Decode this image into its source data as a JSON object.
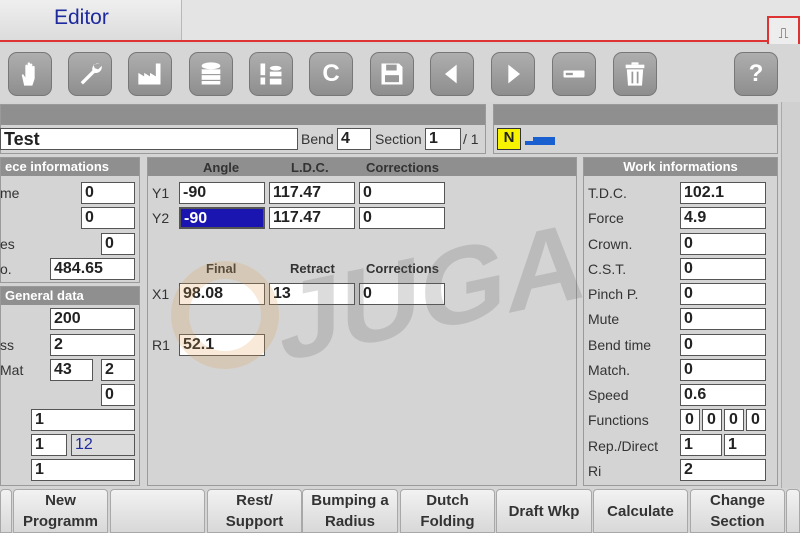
{
  "app": {
    "title": "Editor",
    "corner_glyph": "⎍"
  },
  "toolbar": {
    "buttons": [
      {
        "name": "hand-icon"
      },
      {
        "name": "wrench-icon"
      },
      {
        "name": "factory-icon"
      },
      {
        "name": "database-icon"
      },
      {
        "name": "tool-database-icon"
      },
      {
        "name": "c-icon",
        "glyph": "C"
      },
      {
        "name": "save-icon"
      },
      {
        "name": "arrow-left-icon"
      },
      {
        "name": "arrow-right-icon"
      },
      {
        "name": "minus-icon"
      },
      {
        "name": "trash-icon"
      },
      {
        "name": "help-icon",
        "glyph": "?"
      }
    ]
  },
  "program": {
    "name": "Test",
    "bend_label": "Bend",
    "bend_value": "4",
    "section_label": "Section",
    "section_value": "1",
    "section_total": "/ 1",
    "indicator": "N"
  },
  "piece_info": {
    "header": "ece informations",
    "rows": [
      {
        "label": "me",
        "value": "0"
      },
      {
        "label": "",
        "value": "0"
      },
      {
        "label": "es",
        "value": "0"
      },
      {
        "label": "o.",
        "value": "484.65"
      }
    ]
  },
  "general_data": {
    "header": "General data",
    "row1": "200",
    "row2_label": "ss",
    "row2_value": "2",
    "row3_label": "Mat",
    "row3_value_a": "43",
    "row3_value_b": "2",
    "row4_value": "0",
    "row5_value": "1",
    "row6_value_a": "1",
    "row6_value_b": "12",
    "row7_value": "1"
  },
  "angle_panel": {
    "col_angle": "Angle",
    "col_ldc": "L.D.C.",
    "col_corrections": "Corrections",
    "y1_label": "Y1",
    "y1_angle": "-90",
    "y1_ldc": "117.47",
    "y1_corr": "0",
    "y2_label": "Y2",
    "y2_angle": "-90",
    "y2_ldc": "117.47",
    "y2_corr": "0",
    "col_final": "Final",
    "col_retract": "Retract",
    "col_corrections2": "Corrections",
    "x1_label": "X1",
    "x1_final": "98.08",
    "x1_retract": "13",
    "x1_corr": "0",
    "r1_label": "R1",
    "r1_value": "52.1"
  },
  "work_info": {
    "header": "Work informations",
    "rows": [
      {
        "label": "T.D.C.",
        "value": "102.1"
      },
      {
        "label": "Force",
        "value": "4.9"
      },
      {
        "label": "Crown.",
        "value": "0"
      },
      {
        "label": "C.S.T.",
        "value": "0"
      },
      {
        "label": "Pinch P.",
        "value": "0"
      },
      {
        "label": "Mute",
        "value": "0"
      },
      {
        "label": "Bend time",
        "value": "0"
      },
      {
        "label": "Match.",
        "value": "0"
      },
      {
        "label": "Speed",
        "value": "0.6"
      }
    ],
    "functions_label": "Functions",
    "functions_values": [
      "0",
      "0",
      "0",
      "0"
    ],
    "rep_label": "Rep./Direct",
    "rep_a": "1",
    "rep_b": "1",
    "ri_label": "Ri",
    "ri_value": "2"
  },
  "bottom": {
    "new_programm": [
      "New",
      "Programm"
    ],
    "rest_support": [
      "Rest/",
      "Support"
    ],
    "bumping": [
      "Bumping a",
      "Radius"
    ],
    "dutch": [
      "Dutch",
      "Folding"
    ],
    "draft": "Draft Wkp",
    "calculate": "Calculate",
    "change_section": [
      "Change",
      "Section"
    ]
  },
  "watermark": {
    "text": "JUGAO"
  },
  "colors": {
    "accent_red": "#dd3333",
    "selection_blue": "#1a14b0",
    "title_blue": "#1e2a9e",
    "indicator_yellow": "#f7f300"
  }
}
